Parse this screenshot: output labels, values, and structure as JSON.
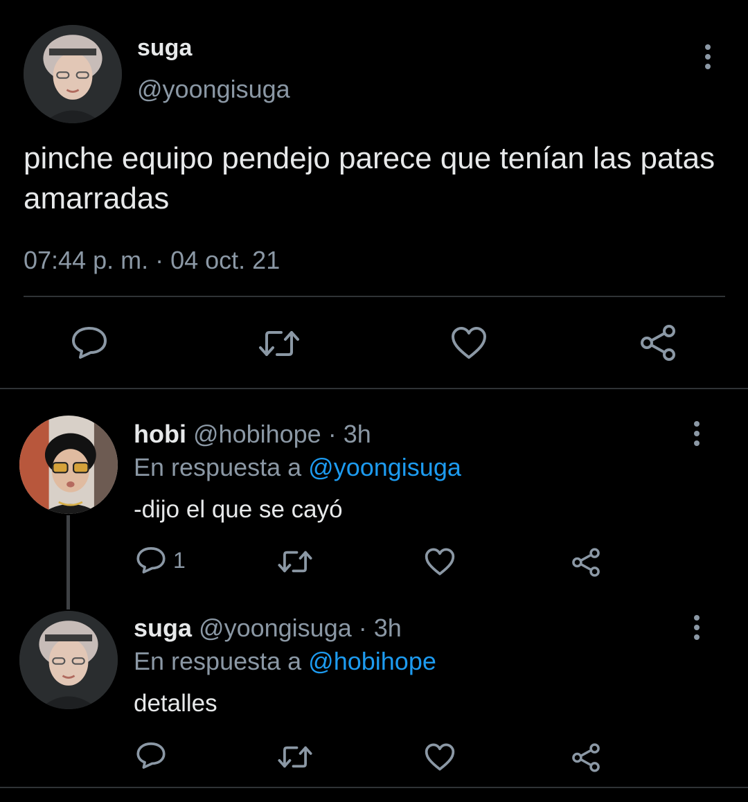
{
  "main_tweet": {
    "name": "suga",
    "handle": "@yoongisuga",
    "text": "pinche equipo pendejo parece que tenían las patas amarradas",
    "timestamp": "07:44 p. m. · 04 oct. 21",
    "actions": {
      "reply_icon": "reply-icon",
      "retweet_icon": "retweet-icon",
      "like_icon": "heart-icon",
      "share_icon": "share-icon"
    }
  },
  "replies": [
    {
      "name": "hobi",
      "handle": "@hobihope",
      "time_sep": " · ",
      "time": "3h",
      "in_reply_prefix": "En respuesta a ",
      "in_reply_to": "@yoongisuga",
      "text": "-dijo el que se cayó",
      "reply_count": "1"
    },
    {
      "name": "suga",
      "handle": "@yoongisuga",
      "time_sep": " · ",
      "time": "3h",
      "in_reply_prefix": "En respuesta a ",
      "in_reply_to": "@hobihope",
      "text": "detalles",
      "reply_count": ""
    }
  ],
  "colors": {
    "background": "#000000",
    "text_primary": "#e7e9ea",
    "text_secondary": "#8b98a5",
    "mention": "#1d9bf0",
    "divider": "#2f3336"
  }
}
